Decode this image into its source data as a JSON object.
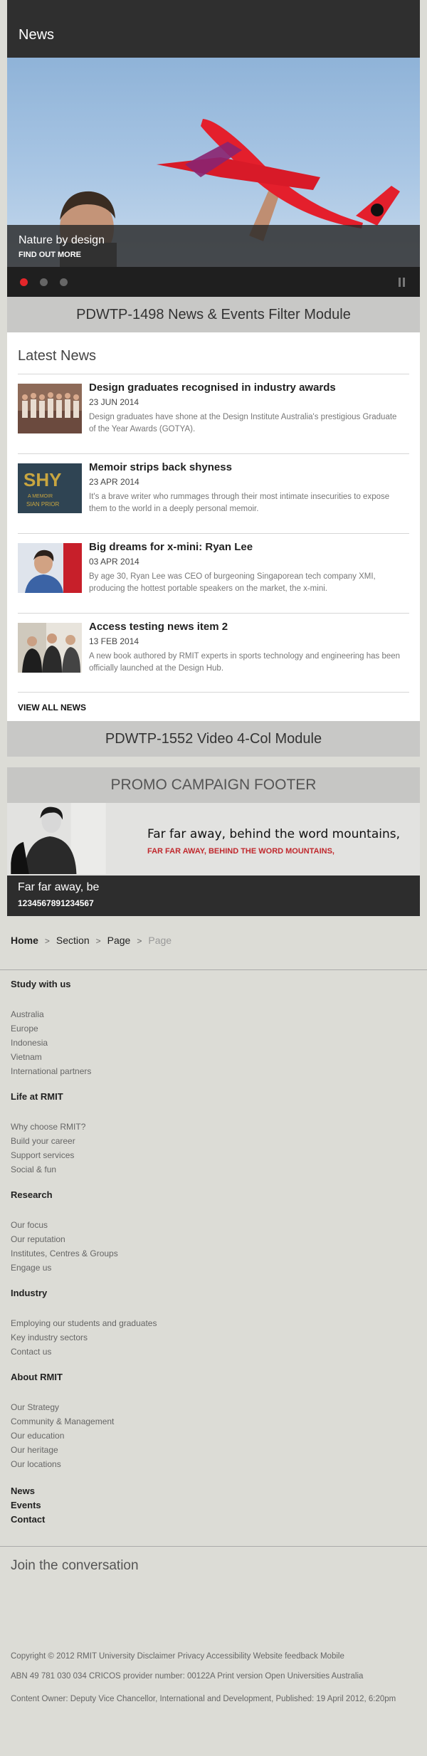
{
  "header": {
    "title": "News"
  },
  "hero": {
    "title": "Nature by design",
    "cta": "FIND OUT MORE"
  },
  "slider": {
    "active_index": 0,
    "count": 3
  },
  "modules": {
    "filter_module": "PDWTP-1498 News & Events Filter Module",
    "video_module": "PDWTP-1552 Video 4-Col Module",
    "promo_footer": "PROMO CAMPAIGN FOOTER"
  },
  "latest": {
    "heading": "Latest News",
    "items": [
      {
        "title": "Design graduates recognised in industry awards",
        "date": "23 JUN 2014",
        "summary": "Design graduates have shone at the Design Institute Australia's prestigious Graduate of the Year Awards (GOTYA)."
      },
      {
        "title": "Memoir strips back shyness",
        "date": "23 APR 2014",
        "summary": "It's a brave writer who rummages through their most intimate insecurities to expose them to the world in a deeply personal memoir.",
        "thumb_text": "SHY",
        "thumb_sub": "A MEMOIR",
        "thumb_author": "SIAN PRIOR"
      },
      {
        "title": "Big dreams for x-mini: Ryan Lee",
        "date": "03 APR 2014",
        "summary": "By age 30, Ryan Lee was CEO of burgeoning Singaporean tech company XMI, producing the hottest portable speakers on the market, the x-mini."
      },
      {
        "title": "Access testing news item 2",
        "date": "13 FEB 2014",
        "summary": "A new book authored by RMIT experts in sports technology and engineering has been officially launched at the Design Hub."
      }
    ],
    "view_all": "VIEW ALL NEWS"
  },
  "promo": {
    "headline": "Far far away, behind the word mountains,",
    "subline": "FAR FAR AWAY, BEHIND THE WORD MOUNTAINS,",
    "strip_title": "Far far away, be",
    "strip_number": "1234567891234567"
  },
  "breadcrumb": [
    "Home",
    "Section",
    "Page",
    "Page"
  ],
  "footer_nav": [
    {
      "heading": "Study with us",
      "links": [
        "Australia",
        "Europe",
        "Indonesia",
        "Vietnam",
        "International partners"
      ]
    },
    {
      "heading": "Life at RMIT",
      "links": [
        "Why choose RMIT?",
        "Build your career",
        "Support services",
        "Social & fun"
      ]
    },
    {
      "heading": "Research",
      "links": [
        "Our focus",
        "Our reputation",
        "Institutes, Centres & Groups",
        "Engage us"
      ]
    },
    {
      "heading": "Industry",
      "links": [
        "Employing our students and graduates",
        "Key industry sectors",
        "Contact us"
      ]
    },
    {
      "heading": "About RMIT",
      "links": [
        "Our Strategy",
        "Community & Management",
        "Our education",
        "Our heritage",
        "Our locations"
      ]
    }
  ],
  "footer_plain_links": [
    "News",
    "Events",
    "Contact"
  ],
  "join": "Join the conversation",
  "copyright": {
    "line1": "Copyright © 2012 RMIT University Disclaimer Privacy Accessibility Website feedback Mobile",
    "line2": "ABN 49 781 030 034 CRICOS provider number: 00122A Print version Open Universities Australia",
    "line3": "Content Owner: Deputy Vice Chancellor, International and Development, Published: 19 April 2012, 6:20pm"
  },
  "colors": {
    "accent_red": "#e3262a",
    "promo_red": "#c0282d",
    "dark_bar": "#2f2f2f"
  }
}
